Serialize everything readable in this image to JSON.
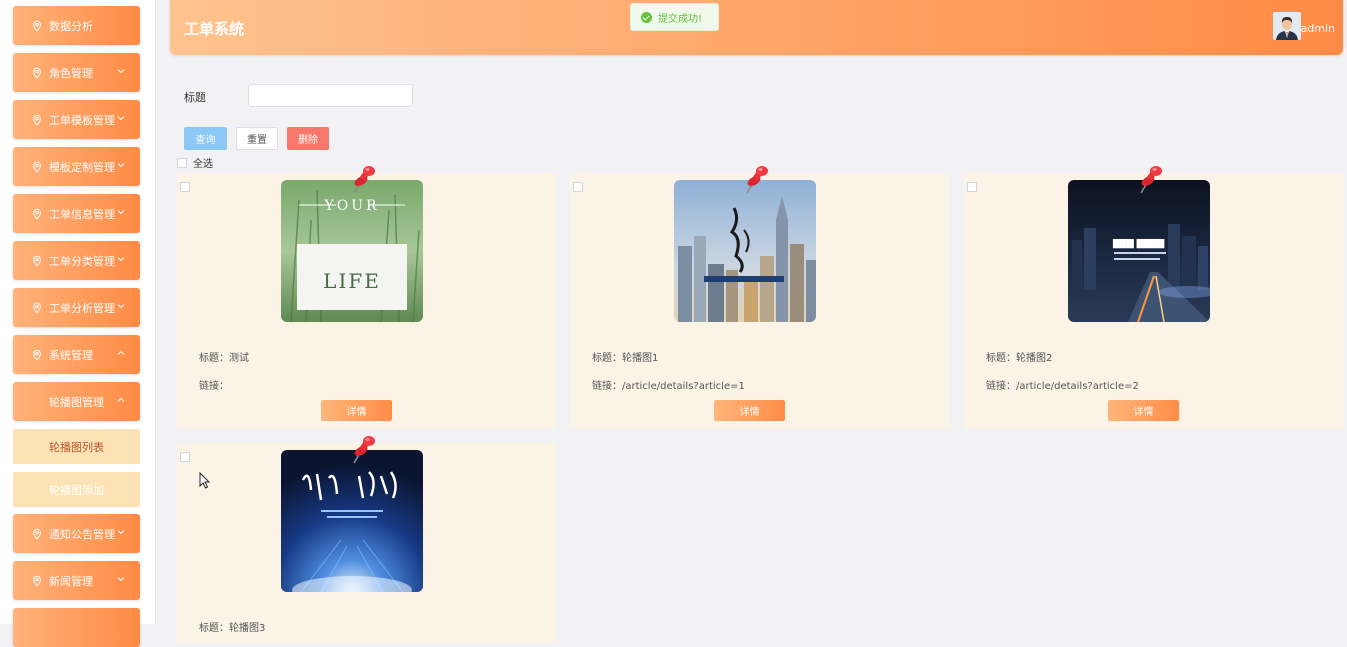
{
  "sidebar": {
    "items": [
      {
        "label": "数据分析",
        "icon": "location-pin-icon",
        "chevron": false
      },
      {
        "label": "角色管理",
        "icon": "location-pin-icon",
        "chevron": "down"
      },
      {
        "label": "工单模板管理",
        "icon": "location-pin-icon",
        "chevron": "down"
      },
      {
        "label": "模板定制管理",
        "icon": "location-pin-icon",
        "chevron": "down"
      },
      {
        "label": "工单信息管理",
        "icon": "location-pin-icon",
        "chevron": "down"
      },
      {
        "label": "工单分类管理",
        "icon": "location-pin-icon",
        "chevron": "down"
      },
      {
        "label": "工单分析管理",
        "icon": "location-pin-icon",
        "chevron": "down"
      },
      {
        "label": "系统管理",
        "icon": "location-pin-icon",
        "chevron": "up"
      },
      {
        "label": "轮播图管理",
        "icon": null,
        "chevron": "up"
      },
      {
        "label": "通知公告管理",
        "icon": "location-pin-icon",
        "chevron": "down"
      },
      {
        "label": "新闻管理",
        "icon": "location-pin-icon",
        "chevron": "down"
      }
    ],
    "sub_items": [
      {
        "label": "轮播图列表",
        "active": true
      },
      {
        "label": "轮播图添加",
        "active": false
      }
    ]
  },
  "header": {
    "title": "工单系统",
    "user": "admin",
    "toast": "提交成功!"
  },
  "search": {
    "label": "标题",
    "value": "",
    "query_button": "查询",
    "reset_button": "重置",
    "delete_button": "删除",
    "select_all": "全选"
  },
  "cards": [
    {
      "title_text": "标题：测试",
      "link_text": "链接：",
      "button": "详情",
      "image": "grass-your-life"
    },
    {
      "title_text": "标题：轮播图1",
      "link_text": "链接：/article/details?article=1",
      "button": "详情",
      "image": "city-skyscrapers"
    },
    {
      "title_text": "标题：轮播图2",
      "link_text": "链接：/article/details?article=2",
      "button": "详情",
      "image": "night-city-road"
    },
    {
      "title_text": "标题：轮播图3",
      "link_text": "",
      "button": "",
      "image": "blue-planet-glow"
    }
  ],
  "colors": {
    "accent_start": "#ffb27a",
    "accent_end": "#ff8b44",
    "card_bg": "#fbf3e6",
    "query": "#8cc8f5",
    "delete": "#f7776a"
  }
}
